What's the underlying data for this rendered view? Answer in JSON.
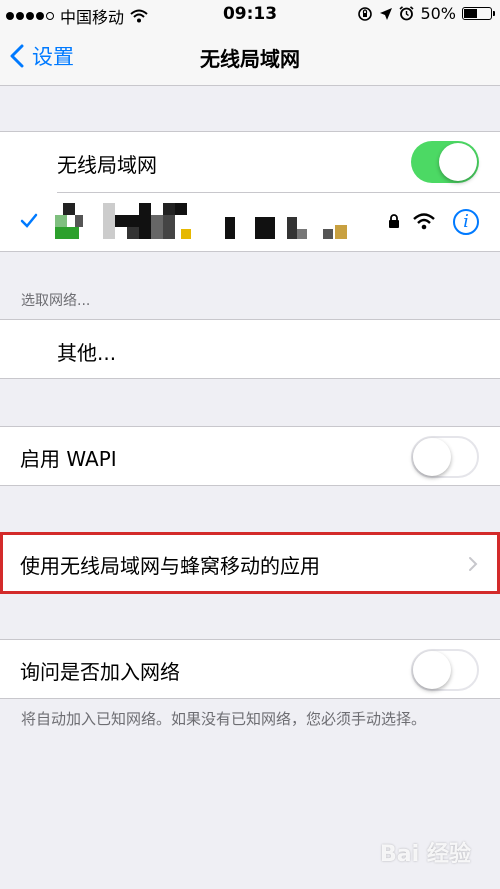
{
  "status_bar": {
    "carrier": "中国移动",
    "time": "09:13",
    "battery": "50%",
    "battery_level": 0.5
  },
  "nav": {
    "back_label": "设置",
    "title": "无线局域网"
  },
  "wifi": {
    "label": "无线局域网",
    "enabled": true,
    "network_name_obscured": true
  },
  "choose_network": {
    "header": "选取网络...",
    "other_label": "其他..."
  },
  "wapi": {
    "label": "启用 WAPI",
    "enabled": false
  },
  "apps": {
    "label": "使用无线局域网与蜂窝移动的应用"
  },
  "ask_join": {
    "label": "询问是否加入网络",
    "enabled": false,
    "footer": "将自动加入已知网络。如果没有已知网络，您必须手动选择。"
  },
  "watermark": "Bai 经验",
  "colors": {
    "accent": "#007aff",
    "toggle_on": "#4cd964",
    "highlight": "#d32a2a"
  }
}
